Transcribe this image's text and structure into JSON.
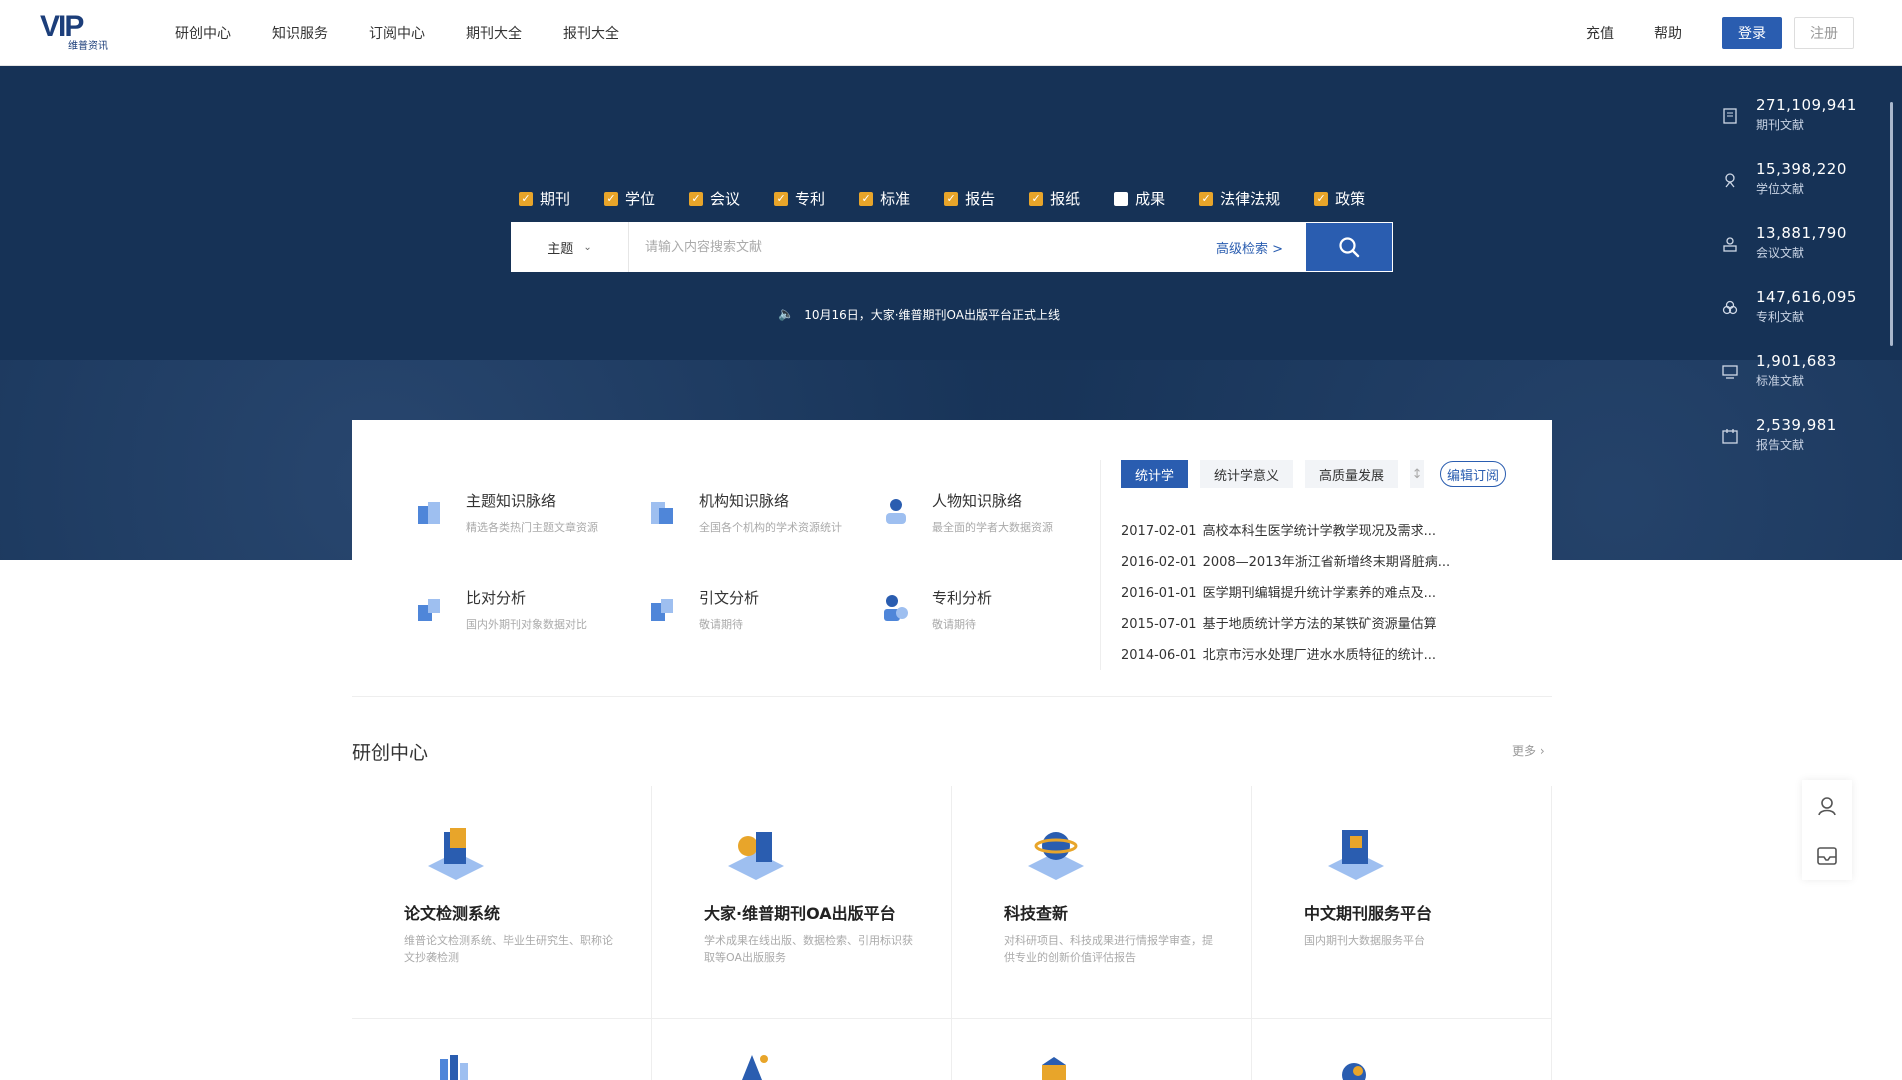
{
  "logo": {
    "mark": "VIP",
    "sub": "维普资讯"
  },
  "nav": {
    "links": [
      "研创中心",
      "知识服务",
      "订阅中心",
      "期刊大全",
      "报刊大全"
    ],
    "recharge": "充值",
    "help": "帮助",
    "login": "登录",
    "register": "注册"
  },
  "search": {
    "types": [
      {
        "label": "期刊",
        "checked": true
      },
      {
        "label": "学位",
        "checked": true
      },
      {
        "label": "会议",
        "checked": true
      },
      {
        "label": "专利",
        "checked": true
      },
      {
        "label": "标准",
        "checked": true
      },
      {
        "label": "报告",
        "checked": true
      },
      {
        "label": "报纸",
        "checked": true
      },
      {
        "label": "成果",
        "checked": false
      },
      {
        "label": "法律法规",
        "checked": true
      },
      {
        "label": "政策",
        "checked": true
      }
    ],
    "scope": "主题",
    "placeholder": "请输入内容搜索文献",
    "advanced": "高级检索 >"
  },
  "notice": "10月16日，大家·维普期刊OA出版平台正式上线",
  "stats": [
    {
      "num": "271,109,941",
      "label": "期刊文献",
      "icon": "journal-icon"
    },
    {
      "num": "15,398,220",
      "label": "学位文献",
      "icon": "degree-icon"
    },
    {
      "num": "13,881,790",
      "label": "会议文献",
      "icon": "conference-icon"
    },
    {
      "num": "147,616,095",
      "label": "专利文献",
      "icon": "patent-icon"
    },
    {
      "num": "1,901,683",
      "label": "标准文献",
      "icon": "standard-icon"
    },
    {
      "num": "2,539,981",
      "label": "报告文献",
      "icon": "report-icon"
    }
  ],
  "tools": [
    {
      "name": "主题知识脉络",
      "desc": "精选各类热门主题文章资源"
    },
    {
      "name": "机构知识脉络",
      "desc": "全国各个机构的学术资源统计"
    },
    {
      "name": "人物知识脉络",
      "desc": "最全面的学者大数据资源"
    },
    {
      "name": "比对分析",
      "desc": "国内外期刊对象数据对比"
    },
    {
      "name": "引文分析",
      "desc": "敬请期待"
    },
    {
      "name": "专利分析",
      "desc": "敬请期待"
    }
  ],
  "tabs": [
    "统计学",
    "统计学意义",
    "高质量发展"
  ],
  "tab_cut": "↕",
  "edit_subscribe": "编辑订阅",
  "news": [
    {
      "date": "2017-02-01",
      "title": "高校本科生医学统计学教学现况及需求..."
    },
    {
      "date": "2016-02-01",
      "title": "2008—2013年浙江省新增终末期肾脏病..."
    },
    {
      "date": "2016-01-01",
      "title": "医学期刊编辑提升统计学素养的难点及..."
    },
    {
      "date": "2015-07-01",
      "title": "基于地质统计学方法的某铁矿资源量估算"
    },
    {
      "date": "2014-06-01",
      "title": "北京市污水处理厂进水水质特征的统计..."
    }
  ],
  "section": {
    "title": "研创中心",
    "more": "更多 ›"
  },
  "cards": [
    {
      "name": "论文检测系统",
      "desc": "维普论文检测系统、毕业生研究生、职称论文抄袭检测"
    },
    {
      "name": "大家·维普期刊OA出版平台",
      "desc": "学术成果在线出版、数据检索、引用标识获取等OA出版服务"
    },
    {
      "name": "科技查新",
      "desc": "对科研项目、科技成果进行情报学审查，提供专业的创新价值评估报告"
    },
    {
      "name": "中文期刊服务平台",
      "desc": "国内期刊大数据服务平台"
    }
  ],
  "colors": {
    "hero": "#163256",
    "accent": "#2a5db0",
    "check": "#e8a52a"
  }
}
